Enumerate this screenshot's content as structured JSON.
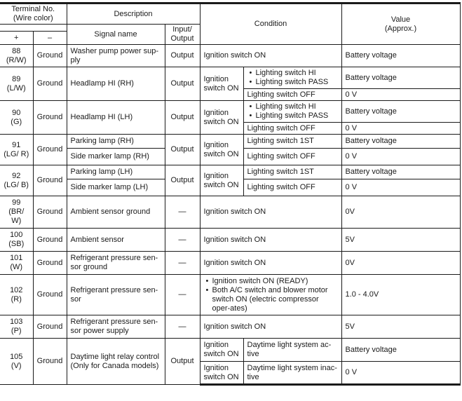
{
  "header": {
    "terminal_no": "Terminal No.",
    "wire_color": "(Wire color)",
    "plus": "+",
    "minus": "–",
    "description": "Description",
    "signal_name": "Signal name",
    "input_output": "Input/ Output",
    "condition": "Condition",
    "value": "Value",
    "value_approx": "(Approx.)"
  },
  "rows": {
    "r88": {
      "terminal": "88",
      "color": "(R/W)",
      "ground": "Ground",
      "signal": "Washer pump power sup-ply",
      "io": "Output",
      "condition": "Ignition switch ON",
      "value": "Battery voltage"
    },
    "r89": {
      "terminal": "89",
      "color": "(L/W)",
      "ground": "Ground",
      "signal": "Headlamp HI (RH)",
      "io": "Output",
      "condition_main": "Ignition switch ON",
      "sub": [
        {
          "bullets": [
            "Lighting switch HI",
            "Lighting switch PASS"
          ],
          "value": "Battery voltage"
        },
        {
          "text": "Lighting switch OFF",
          "value": "0 V"
        }
      ]
    },
    "r90": {
      "terminal": "90",
      "color": "(G)",
      "ground": "Ground",
      "signal": "Headlamp HI (LH)",
      "io": "Output",
      "condition_main": "Ignition switch ON",
      "sub": [
        {
          "bullets": [
            "Lighting switch HI",
            "Lighting switch PASS"
          ],
          "value": "Battery voltage"
        },
        {
          "text": "Lighting switch OFF",
          "value": "0 V"
        }
      ]
    },
    "r91": {
      "terminal": "91",
      "color": "(LG/ R)",
      "ground": "Ground",
      "signals": [
        "Parking lamp (RH)",
        "Side marker lamp (RH)"
      ],
      "io": "Output",
      "condition_main": "Ignition switch ON",
      "sub": [
        {
          "text": "Lighting switch 1ST",
          "value": "Battery voltage"
        },
        {
          "text": "Lighting switch OFF",
          "value": "0 V"
        }
      ]
    },
    "r92": {
      "terminal": "92",
      "color": "(LG/ B)",
      "ground": "Ground",
      "signals": [
        "Parking lamp (LH)",
        "Side marker lamp (LH)"
      ],
      "io": "Output",
      "condition_main": "Ignition switch ON",
      "sub": [
        {
          "text": "Lighting switch 1ST",
          "value": "Battery voltage"
        },
        {
          "text": "Lighting switch OFF",
          "value": "0 V"
        }
      ]
    },
    "r99": {
      "terminal": "99",
      "color": "(BR/ W)",
      "ground": "Ground",
      "signal": "Ambient sensor ground",
      "io": "—",
      "condition": "Ignition switch ON",
      "value": "0V"
    },
    "r100": {
      "terminal": "100",
      "color": "(SB)",
      "ground": "Ground",
      "signal": "Ambient sensor",
      "io": "—",
      "condition": "Ignition switch ON",
      "value": "5V"
    },
    "r101": {
      "terminal": "101",
      "color": "(W)",
      "ground": "Ground",
      "signal": "Refrigerant pressure sen-sor ground",
      "io": "—",
      "condition": "Ignition switch ON",
      "value": "0V"
    },
    "r102": {
      "terminal": "102",
      "color": "(R)",
      "ground": "Ground",
      "signal": "Refrigerant pressure sen-sor",
      "io": "—",
      "condition_bullets": [
        "Ignition switch ON (READY)",
        "Both A/C switch and blower motor switch ON (electric compressor oper-ates)"
      ],
      "value": "1.0 - 4.0V"
    },
    "r103": {
      "terminal": "103",
      "color": "(P)",
      "ground": "Ground",
      "signal": "Refrigerant pressure sen-sor power supply",
      "io": "—",
      "condition": "Ignition switch ON",
      "value": "5V"
    },
    "r105": {
      "terminal": "105",
      "color": "(V)",
      "ground": "Ground",
      "signal": "Daytime light relay control (Only for Canada models)",
      "io": "Output",
      "sub": [
        {
          "main": "Ignition switch ON",
          "text": "Daytime light system ac-tive",
          "value": "Battery voltage"
        },
        {
          "main": "Ignition switch ON",
          "text": "Daytime light system inac-tive",
          "value": "0 V"
        }
      ]
    }
  }
}
